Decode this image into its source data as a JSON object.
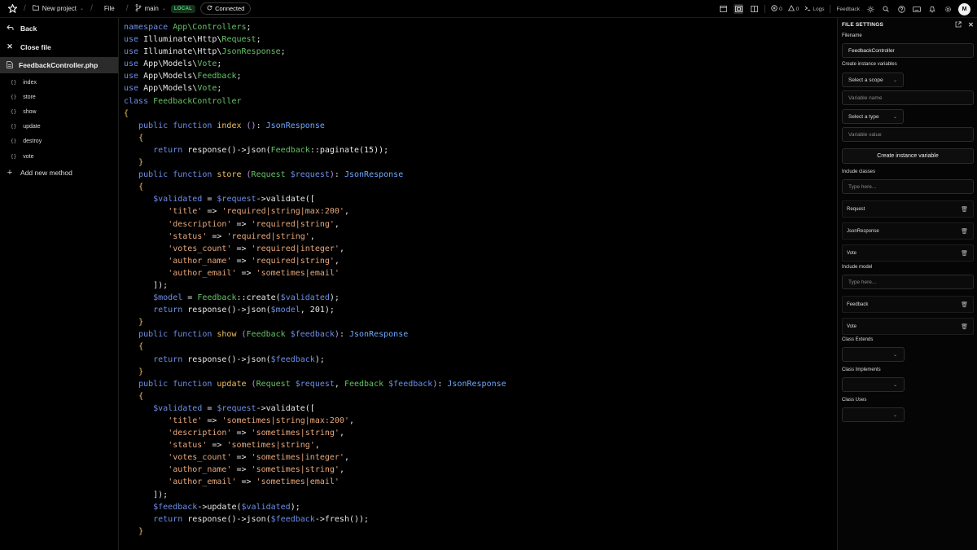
{
  "topbar": {
    "project": "New project",
    "file": "File",
    "branch": "main",
    "badge": "LOCAL",
    "status": "Connected",
    "errors": "0",
    "warnings": "0",
    "logs": "Logs",
    "feedback": "Feedback",
    "avatar": "M"
  },
  "sidebar": {
    "back": "Back",
    "close": "Close file",
    "file": "FeedbackController.php",
    "methods": [
      "index",
      "store",
      "show",
      "update",
      "destroy",
      "vote"
    ],
    "add": "Add new method"
  },
  "panel": {
    "title": "FILE SETTINGS",
    "filename_label": "Filename",
    "filename_value": "FeedbackController",
    "vars_label": "Create instance variables",
    "scope_select": "Select a scope",
    "var_name_ph": "Variable name",
    "type_select": "Select a type",
    "var_value_ph": "Variable value",
    "create_button": "Create instance variable",
    "classes_label": "Include classes",
    "classes_ph": "Type here...",
    "classes": [
      "Request",
      "JsonResponse",
      "Vote"
    ],
    "model_label": "Include model",
    "model_ph": "Type here...",
    "models": [
      "Feedback",
      "Vote"
    ],
    "extends_label": "Class Extends",
    "implements_label": "Class Implements",
    "uses_label": "Class Uses"
  },
  "code": [
    [
      [
        "kw",
        "namespace "
      ],
      [
        "ns",
        "App\\Controllers"
      ],
      [
        "t",
        ";"
      ]
    ],
    [
      [
        "kw",
        "use "
      ],
      [
        "t",
        "Illuminate\\Http\\"
      ],
      [
        "ns",
        "Request"
      ],
      [
        "t",
        ";"
      ]
    ],
    [
      [
        "kw",
        "use "
      ],
      [
        "t",
        "Illuminate\\Http\\"
      ],
      [
        "ns",
        "JsonResponse"
      ],
      [
        "t",
        ";"
      ]
    ],
    [
      [
        "kw",
        "use "
      ],
      [
        "t",
        "App\\Models\\"
      ],
      [
        "ns",
        "Vote"
      ],
      [
        "t",
        ";"
      ]
    ],
    [
      [
        "kw",
        "use "
      ],
      [
        "t",
        "App\\Models\\"
      ],
      [
        "ns",
        "Feedback"
      ],
      [
        "t",
        ";"
      ]
    ],
    [
      [
        "kw",
        "use "
      ],
      [
        "t",
        "App\\Models\\"
      ],
      [
        "ns",
        "Vote"
      ],
      [
        "t",
        ";"
      ]
    ],
    [
      [
        "kw",
        "class "
      ],
      [
        "cls",
        "FeedbackController"
      ]
    ],
    [
      [
        "brace",
        "{"
      ]
    ],
    [
      [
        "t",
        "  "
      ],
      [
        "kw",
        "public function "
      ],
      [
        "fn",
        "index"
      ],
      [
        "par",
        " ()"
      ],
      [
        "t",
        ": "
      ],
      [
        "typ",
        "JsonResponse"
      ]
    ],
    [
      [
        "t",
        "  "
      ],
      [
        "brace",
        "{"
      ]
    ],
    [
      [
        "t",
        "    "
      ],
      [
        "kw",
        "return "
      ],
      [
        "t",
        "response()->json("
      ],
      [
        "cls",
        "Feedback"
      ],
      [
        "t",
        "::paginate(15));"
      ]
    ],
    [
      [
        "t",
        "  "
      ],
      [
        "brace",
        "}"
      ]
    ],
    [
      [
        "t",
        "  "
      ],
      [
        "kw",
        "public function "
      ],
      [
        "fn",
        "store"
      ],
      [
        "par",
        " ("
      ],
      [
        "cls",
        "Request "
      ],
      [
        "var",
        "$request"
      ],
      [
        "par",
        ")"
      ],
      [
        "t",
        ": "
      ],
      [
        "typ",
        "JsonResponse"
      ]
    ],
    [
      [
        "t",
        "  "
      ],
      [
        "brace",
        "{"
      ]
    ],
    [
      [
        "t",
        "    "
      ],
      [
        "var",
        "$validated"
      ],
      [
        "t",
        " = "
      ],
      [
        "var",
        "$request"
      ],
      [
        "t",
        "->validate(["
      ]
    ],
    [
      [
        "t",
        "      "
      ],
      [
        "str",
        "'title'"
      ],
      [
        "t",
        " => "
      ],
      [
        "str",
        "'required|string|max:200'"
      ],
      [
        "t",
        ","
      ]
    ],
    [
      [
        "t",
        "      "
      ],
      [
        "str",
        "'description'"
      ],
      [
        "t",
        " => "
      ],
      [
        "str",
        "'required|string'"
      ],
      [
        "t",
        ","
      ]
    ],
    [
      [
        "t",
        "      "
      ],
      [
        "str",
        "'status'"
      ],
      [
        "t",
        " => "
      ],
      [
        "str",
        "'required|string'"
      ],
      [
        "t",
        ","
      ]
    ],
    [
      [
        "t",
        "      "
      ],
      [
        "str",
        "'votes_count'"
      ],
      [
        "t",
        " => "
      ],
      [
        "str",
        "'required|integer'"
      ],
      [
        "t",
        ","
      ]
    ],
    [
      [
        "t",
        "      "
      ],
      [
        "str",
        "'author_name'"
      ],
      [
        "t",
        " => "
      ],
      [
        "str",
        "'required|string'"
      ],
      [
        "t",
        ","
      ]
    ],
    [
      [
        "t",
        "      "
      ],
      [
        "str",
        "'author_email'"
      ],
      [
        "t",
        " => "
      ],
      [
        "str",
        "'sometimes|email'"
      ]
    ],
    [
      [
        "t",
        "    ]);"
      ]
    ],
    [
      [
        "t",
        "    "
      ],
      [
        "var",
        "$model"
      ],
      [
        "t",
        " = "
      ],
      [
        "cls",
        "Feedback"
      ],
      [
        "t",
        "::create("
      ],
      [
        "var",
        "$validated"
      ],
      [
        "t",
        ");"
      ]
    ],
    [
      [
        "t",
        "    "
      ],
      [
        "kw",
        "return "
      ],
      [
        "t",
        "response()->json("
      ],
      [
        "var",
        "$model"
      ],
      [
        "t",
        ", 201);"
      ]
    ],
    [
      [
        "t",
        "  "
      ],
      [
        "brace",
        "}"
      ]
    ],
    [
      [
        "t",
        "  "
      ],
      [
        "kw",
        "public function "
      ],
      [
        "fn",
        "show"
      ],
      [
        "par",
        " ("
      ],
      [
        "cls",
        "Feedback "
      ],
      [
        "var",
        "$feedback"
      ],
      [
        "par",
        ")"
      ],
      [
        "t",
        ": "
      ],
      [
        "typ",
        "JsonResponse"
      ]
    ],
    [
      [
        "t",
        "  "
      ],
      [
        "brace",
        "{"
      ]
    ],
    [
      [
        "t",
        "    "
      ],
      [
        "kw",
        "return "
      ],
      [
        "t",
        "response()->json("
      ],
      [
        "var",
        "$feedback"
      ],
      [
        "t",
        ");"
      ]
    ],
    [
      [
        "t",
        "  "
      ],
      [
        "brace",
        "}"
      ]
    ],
    [
      [
        "t",
        "  "
      ],
      [
        "kw",
        "public function "
      ],
      [
        "fn",
        "update"
      ],
      [
        "par",
        " ("
      ],
      [
        "cls",
        "Request "
      ],
      [
        "var",
        "$request"
      ],
      [
        "t",
        ", "
      ],
      [
        "cls",
        "Feedback "
      ],
      [
        "var",
        "$feedback"
      ],
      [
        "par",
        ")"
      ],
      [
        "t",
        ": "
      ],
      [
        "typ",
        "JsonResponse"
      ]
    ],
    [
      [
        "t",
        "  "
      ],
      [
        "brace",
        "{"
      ]
    ],
    [
      [
        "t",
        "    "
      ],
      [
        "var",
        "$validated"
      ],
      [
        "t",
        " = "
      ],
      [
        "var",
        "$request"
      ],
      [
        "t",
        "->validate(["
      ]
    ],
    [
      [
        "t",
        "      "
      ],
      [
        "str",
        "'title'"
      ],
      [
        "t",
        " => "
      ],
      [
        "str",
        "'sometimes|string|max:200'"
      ],
      [
        "t",
        ","
      ]
    ],
    [
      [
        "t",
        "      "
      ],
      [
        "str",
        "'description'"
      ],
      [
        "t",
        " => "
      ],
      [
        "str",
        "'sometimes|string'"
      ],
      [
        "t",
        ","
      ]
    ],
    [
      [
        "t",
        "      "
      ],
      [
        "str",
        "'status'"
      ],
      [
        "t",
        " => "
      ],
      [
        "str",
        "'sometimes|string'"
      ],
      [
        "t",
        ","
      ]
    ],
    [
      [
        "t",
        "      "
      ],
      [
        "str",
        "'votes_count'"
      ],
      [
        "t",
        " => "
      ],
      [
        "str",
        "'sometimes|integer'"
      ],
      [
        "t",
        ","
      ]
    ],
    [
      [
        "t",
        "      "
      ],
      [
        "str",
        "'author_name'"
      ],
      [
        "t",
        " => "
      ],
      [
        "str",
        "'sometimes|string'"
      ],
      [
        "t",
        ","
      ]
    ],
    [
      [
        "t",
        "      "
      ],
      [
        "str",
        "'author_email'"
      ],
      [
        "t",
        " => "
      ],
      [
        "str",
        "'sometimes|email'"
      ]
    ],
    [
      [
        "t",
        "    ]);"
      ]
    ],
    [
      [
        "t",
        "    "
      ],
      [
        "var",
        "$feedback"
      ],
      [
        "t",
        "->update("
      ],
      [
        "var",
        "$validated"
      ],
      [
        "t",
        ");"
      ]
    ],
    [
      [
        "t",
        "    "
      ],
      [
        "kw",
        "return "
      ],
      [
        "t",
        "response()->json("
      ],
      [
        "var",
        "$feedback"
      ],
      [
        "t",
        "->fresh());"
      ]
    ],
    [
      [
        "t",
        "  "
      ],
      [
        "brace",
        "}"
      ]
    ]
  ]
}
